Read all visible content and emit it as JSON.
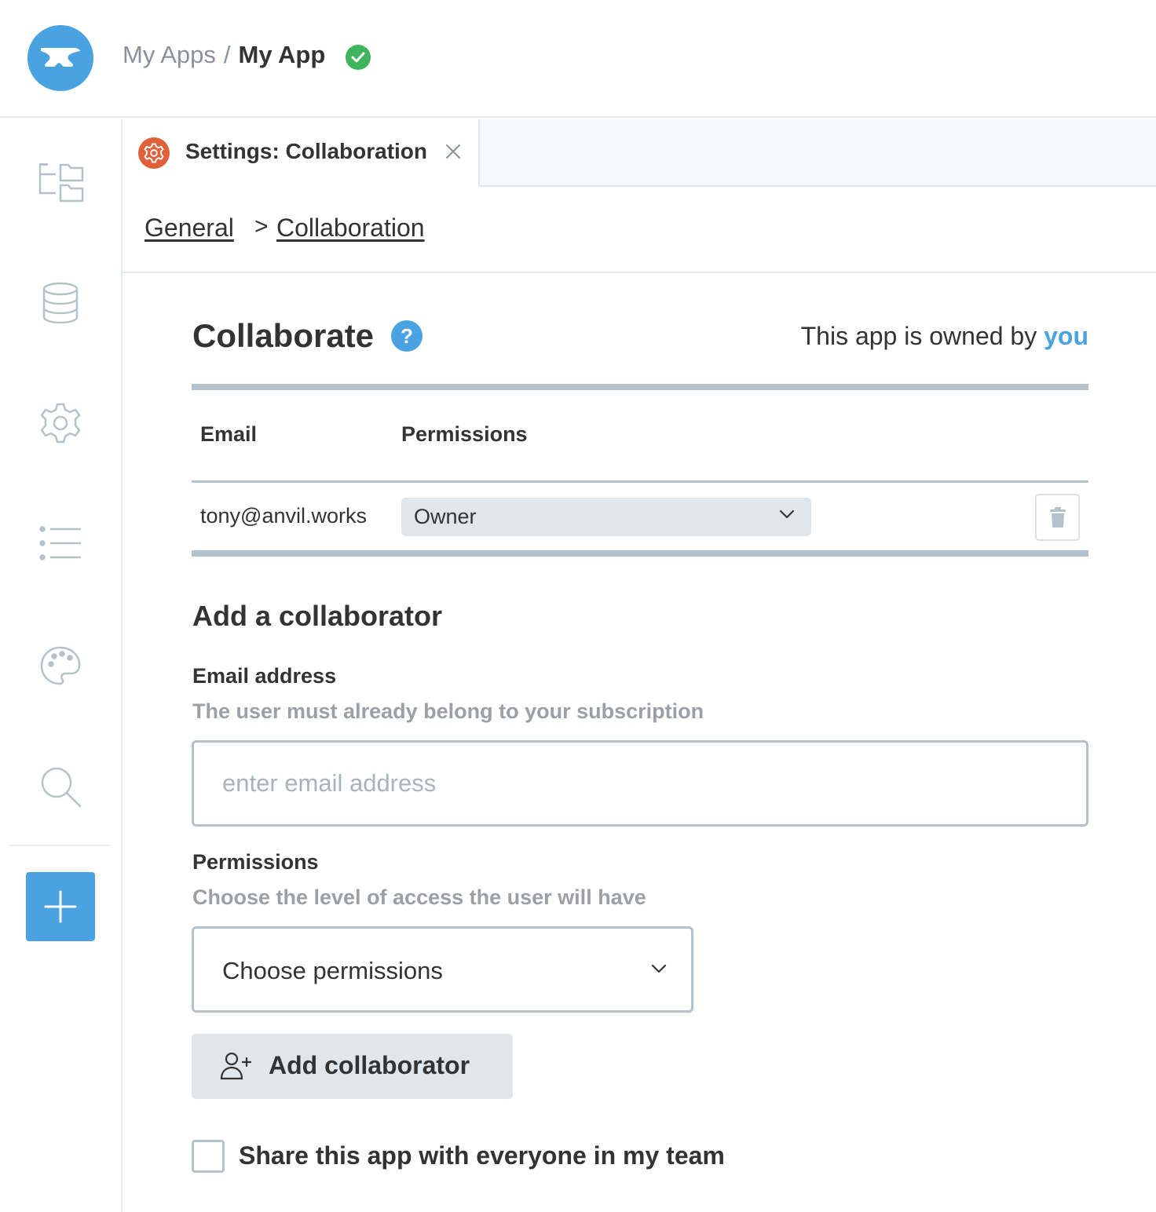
{
  "header": {
    "logo_icon": "anvil-logo-icon",
    "breadcrumb_parent": "My Apps",
    "breadcrumb_separator": "/",
    "app_name": "My App",
    "status_icon": "check-circle-icon",
    "status_color": "#3fb35e"
  },
  "sidebar": {
    "items": [
      {
        "icon": "app-tree-icon"
      },
      {
        "icon": "database-icon"
      },
      {
        "icon": "settings-gear-icon"
      },
      {
        "icon": "list-icon"
      },
      {
        "icon": "palette-icon"
      },
      {
        "icon": "search-icon"
      }
    ],
    "add_icon": "plus-icon",
    "accent_color": "#4aa3e0"
  },
  "tab": {
    "icon": "settings-gear-icon",
    "label": "Settings: Collaboration",
    "close_icon": "close-icon"
  },
  "breadcrumb": {
    "general": "General",
    "separator": ">",
    "collaboration": "Collaboration"
  },
  "collaborate": {
    "title": "Collaborate",
    "help_label": "?",
    "owner_prefix": "This app is owned by ",
    "owner_name": "you",
    "table": {
      "columns": [
        "Email",
        "Permissions"
      ],
      "rows": [
        {
          "email": "tony@anvil.works",
          "permission": "Owner"
        }
      ]
    }
  },
  "add_collaborator": {
    "title": "Add a collaborator",
    "email_label": "Email address",
    "email_hint": "The user must already belong to your subscription",
    "email_placeholder": "enter email address",
    "permissions_label": "Permissions",
    "permissions_hint": "Choose the level of access the user will have",
    "permissions_placeholder": "Choose permissions",
    "button_label": "Add collaborator",
    "share_team_label": "Share this app with everyone in my team",
    "share_team_checked": false
  }
}
